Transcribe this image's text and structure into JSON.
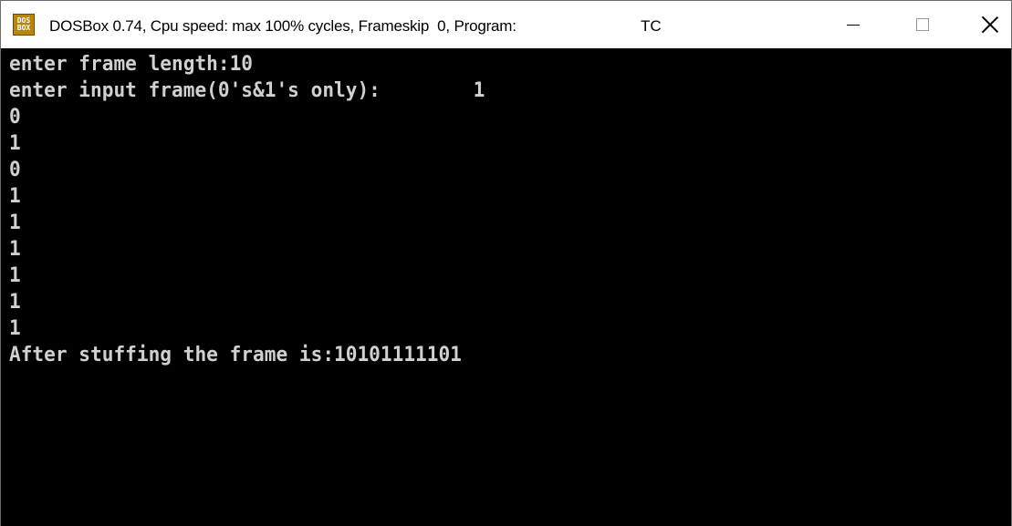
{
  "window": {
    "title": "DOSBox 0.74, Cpu speed: max 100% cycles, Frameskip  0, Program:",
    "program": "TC",
    "icon": "dosbox-icon",
    "icon_text_top": "DOS",
    "icon_text_bottom": "BOX",
    "controls": {
      "minimize": "minimize-icon",
      "maximize": "maximize-icon",
      "close": "close-icon"
    }
  },
  "console": {
    "background": "#000000",
    "foreground": "#d0d0d0",
    "lines": [
      "enter frame length:10",
      "enter input frame(0's&1's only):        1",
      "0",
      "1",
      "0",
      "1",
      "1",
      "1",
      "1",
      "1",
      "1",
      "After stuffing the frame is:10101111101"
    ]
  }
}
